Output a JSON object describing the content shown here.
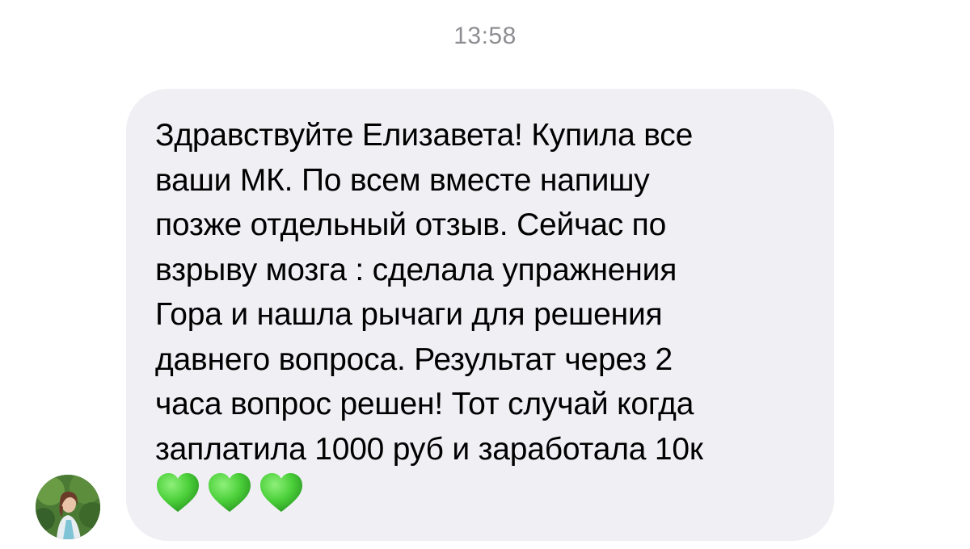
{
  "timestamp": "13:58",
  "message": {
    "sender_avatar": "user-photo-avatar",
    "text_lines": [
      "Здравствуйте Елизавета! Купила все",
      "ваши МК. По всем вместе напишу",
      "позже отдельный отзыв. Сейчас по",
      "взрыву мозга : сделала упражнения",
      "Гора и нашла рычаги для решения",
      "давнего вопроса. Результат через 2",
      "часа вопрос решен! Тот случай когда",
      "заплатила 1000 руб и заработала 10к"
    ],
    "emoji": [
      "green-heart-icon",
      "green-heart-icon",
      "green-heart-icon"
    ]
  },
  "colors": {
    "bubble_bg": "#efeff4",
    "timestamp": "#8e8e93",
    "heart": "#4cd03a"
  }
}
